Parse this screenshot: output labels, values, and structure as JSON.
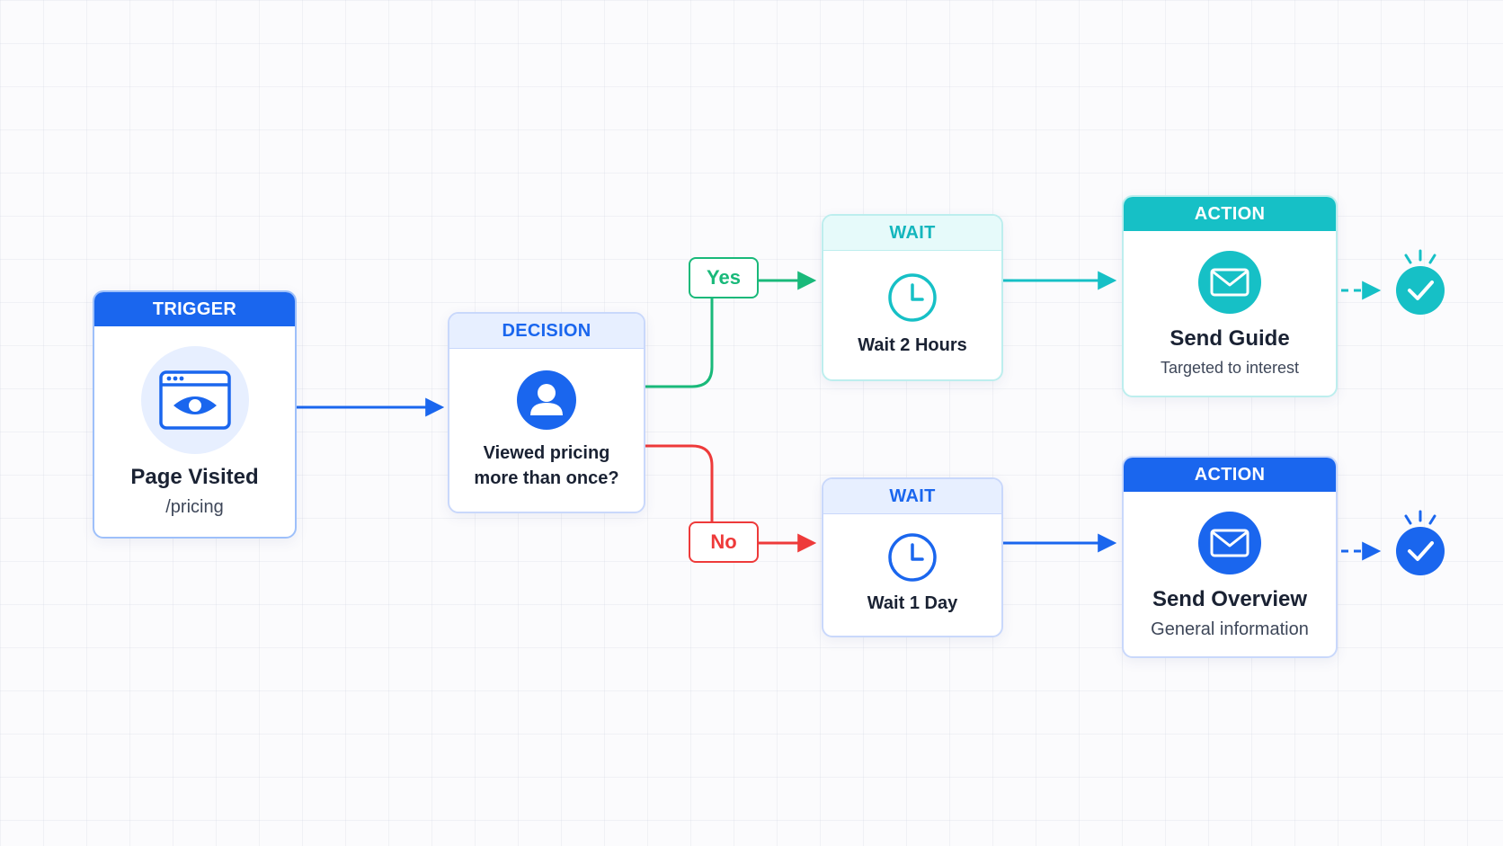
{
  "colors": {
    "blue": "#1a66ee",
    "teal": "#16c0c6",
    "green": "#19b97a",
    "red": "#ee3a3a",
    "dark_text": "#1a2233",
    "muted_text": "#3e4759"
  },
  "trigger": {
    "header": "TRIGGER",
    "icon": "browser-eye-icon",
    "title": "Page Visited",
    "subtitle": "/pricing"
  },
  "decision": {
    "header": "DECISION",
    "icon": "user-icon",
    "question_line1": "Viewed pricing",
    "question_line2": "more than once?"
  },
  "branches": {
    "yes_label": "Yes",
    "no_label": "No"
  },
  "wait_yes": {
    "header": "WAIT",
    "icon": "clock-icon",
    "label": "Wait 2 Hours"
  },
  "wait_no": {
    "header": "WAIT",
    "icon": "clock-icon",
    "label": "Wait 1 Day"
  },
  "action_yes": {
    "header": "ACTION",
    "icon": "mail-icon",
    "title": "Send Guide",
    "subtitle": "Targeted to interest"
  },
  "action_no": {
    "header": "ACTION",
    "icon": "mail-icon",
    "title": "Send Overview",
    "subtitle": "General information"
  },
  "end_markers": {
    "yes_icon": "check-circle-icon",
    "no_icon": "check-circle-icon"
  }
}
